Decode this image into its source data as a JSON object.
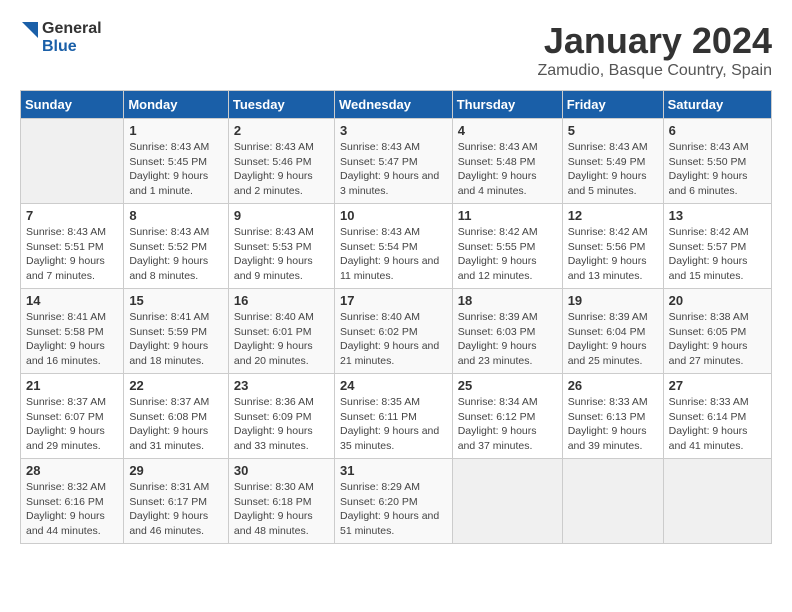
{
  "logo": {
    "line1": "General",
    "line2": "Blue"
  },
  "title": "January 2024",
  "subtitle": "Zamudio, Basque Country, Spain",
  "days_of_week": [
    "Sunday",
    "Monday",
    "Tuesday",
    "Wednesday",
    "Thursday",
    "Friday",
    "Saturday"
  ],
  "weeks": [
    [
      {
        "day": "",
        "sunrise": "",
        "sunset": "",
        "daylight": "",
        "empty": true
      },
      {
        "day": "1",
        "sunrise": "Sunrise: 8:43 AM",
        "sunset": "Sunset: 5:45 PM",
        "daylight": "Daylight: 9 hours and 1 minute."
      },
      {
        "day": "2",
        "sunrise": "Sunrise: 8:43 AM",
        "sunset": "Sunset: 5:46 PM",
        "daylight": "Daylight: 9 hours and 2 minutes."
      },
      {
        "day": "3",
        "sunrise": "Sunrise: 8:43 AM",
        "sunset": "Sunset: 5:47 PM",
        "daylight": "Daylight: 9 hours and 3 minutes."
      },
      {
        "day": "4",
        "sunrise": "Sunrise: 8:43 AM",
        "sunset": "Sunset: 5:48 PM",
        "daylight": "Daylight: 9 hours and 4 minutes."
      },
      {
        "day": "5",
        "sunrise": "Sunrise: 8:43 AM",
        "sunset": "Sunset: 5:49 PM",
        "daylight": "Daylight: 9 hours and 5 minutes."
      },
      {
        "day": "6",
        "sunrise": "Sunrise: 8:43 AM",
        "sunset": "Sunset: 5:50 PM",
        "daylight": "Daylight: 9 hours and 6 minutes."
      }
    ],
    [
      {
        "day": "7",
        "sunrise": "Sunrise: 8:43 AM",
        "sunset": "Sunset: 5:51 PM",
        "daylight": "Daylight: 9 hours and 7 minutes."
      },
      {
        "day": "8",
        "sunrise": "Sunrise: 8:43 AM",
        "sunset": "Sunset: 5:52 PM",
        "daylight": "Daylight: 9 hours and 8 minutes."
      },
      {
        "day": "9",
        "sunrise": "Sunrise: 8:43 AM",
        "sunset": "Sunset: 5:53 PM",
        "daylight": "Daylight: 9 hours and 9 minutes."
      },
      {
        "day": "10",
        "sunrise": "Sunrise: 8:43 AM",
        "sunset": "Sunset: 5:54 PM",
        "daylight": "Daylight: 9 hours and 11 minutes."
      },
      {
        "day": "11",
        "sunrise": "Sunrise: 8:42 AM",
        "sunset": "Sunset: 5:55 PM",
        "daylight": "Daylight: 9 hours and 12 minutes."
      },
      {
        "day": "12",
        "sunrise": "Sunrise: 8:42 AM",
        "sunset": "Sunset: 5:56 PM",
        "daylight": "Daylight: 9 hours and 13 minutes."
      },
      {
        "day": "13",
        "sunrise": "Sunrise: 8:42 AM",
        "sunset": "Sunset: 5:57 PM",
        "daylight": "Daylight: 9 hours and 15 minutes."
      }
    ],
    [
      {
        "day": "14",
        "sunrise": "Sunrise: 8:41 AM",
        "sunset": "Sunset: 5:58 PM",
        "daylight": "Daylight: 9 hours and 16 minutes."
      },
      {
        "day": "15",
        "sunrise": "Sunrise: 8:41 AM",
        "sunset": "Sunset: 5:59 PM",
        "daylight": "Daylight: 9 hours and 18 minutes."
      },
      {
        "day": "16",
        "sunrise": "Sunrise: 8:40 AM",
        "sunset": "Sunset: 6:01 PM",
        "daylight": "Daylight: 9 hours and 20 minutes."
      },
      {
        "day": "17",
        "sunrise": "Sunrise: 8:40 AM",
        "sunset": "Sunset: 6:02 PM",
        "daylight": "Daylight: 9 hours and 21 minutes."
      },
      {
        "day": "18",
        "sunrise": "Sunrise: 8:39 AM",
        "sunset": "Sunset: 6:03 PM",
        "daylight": "Daylight: 9 hours and 23 minutes."
      },
      {
        "day": "19",
        "sunrise": "Sunrise: 8:39 AM",
        "sunset": "Sunset: 6:04 PM",
        "daylight": "Daylight: 9 hours and 25 minutes."
      },
      {
        "day": "20",
        "sunrise": "Sunrise: 8:38 AM",
        "sunset": "Sunset: 6:05 PM",
        "daylight": "Daylight: 9 hours and 27 minutes."
      }
    ],
    [
      {
        "day": "21",
        "sunrise": "Sunrise: 8:37 AM",
        "sunset": "Sunset: 6:07 PM",
        "daylight": "Daylight: 9 hours and 29 minutes."
      },
      {
        "day": "22",
        "sunrise": "Sunrise: 8:37 AM",
        "sunset": "Sunset: 6:08 PM",
        "daylight": "Daylight: 9 hours and 31 minutes."
      },
      {
        "day": "23",
        "sunrise": "Sunrise: 8:36 AM",
        "sunset": "Sunset: 6:09 PM",
        "daylight": "Daylight: 9 hours and 33 minutes."
      },
      {
        "day": "24",
        "sunrise": "Sunrise: 8:35 AM",
        "sunset": "Sunset: 6:11 PM",
        "daylight": "Daylight: 9 hours and 35 minutes."
      },
      {
        "day": "25",
        "sunrise": "Sunrise: 8:34 AM",
        "sunset": "Sunset: 6:12 PM",
        "daylight": "Daylight: 9 hours and 37 minutes."
      },
      {
        "day": "26",
        "sunrise": "Sunrise: 8:33 AM",
        "sunset": "Sunset: 6:13 PM",
        "daylight": "Daylight: 9 hours and 39 minutes."
      },
      {
        "day": "27",
        "sunrise": "Sunrise: 8:33 AM",
        "sunset": "Sunset: 6:14 PM",
        "daylight": "Daylight: 9 hours and 41 minutes."
      }
    ],
    [
      {
        "day": "28",
        "sunrise": "Sunrise: 8:32 AM",
        "sunset": "Sunset: 6:16 PM",
        "daylight": "Daylight: 9 hours and 44 minutes."
      },
      {
        "day": "29",
        "sunrise": "Sunrise: 8:31 AM",
        "sunset": "Sunset: 6:17 PM",
        "daylight": "Daylight: 9 hours and 46 minutes."
      },
      {
        "day": "30",
        "sunrise": "Sunrise: 8:30 AM",
        "sunset": "Sunset: 6:18 PM",
        "daylight": "Daylight: 9 hours and 48 minutes."
      },
      {
        "day": "31",
        "sunrise": "Sunrise: 8:29 AM",
        "sunset": "Sunset: 6:20 PM",
        "daylight": "Daylight: 9 hours and 51 minutes."
      },
      {
        "day": "",
        "sunrise": "",
        "sunset": "",
        "daylight": "",
        "empty": true
      },
      {
        "day": "",
        "sunrise": "",
        "sunset": "",
        "daylight": "",
        "empty": true
      },
      {
        "day": "",
        "sunrise": "",
        "sunset": "",
        "daylight": "",
        "empty": true
      }
    ]
  ]
}
